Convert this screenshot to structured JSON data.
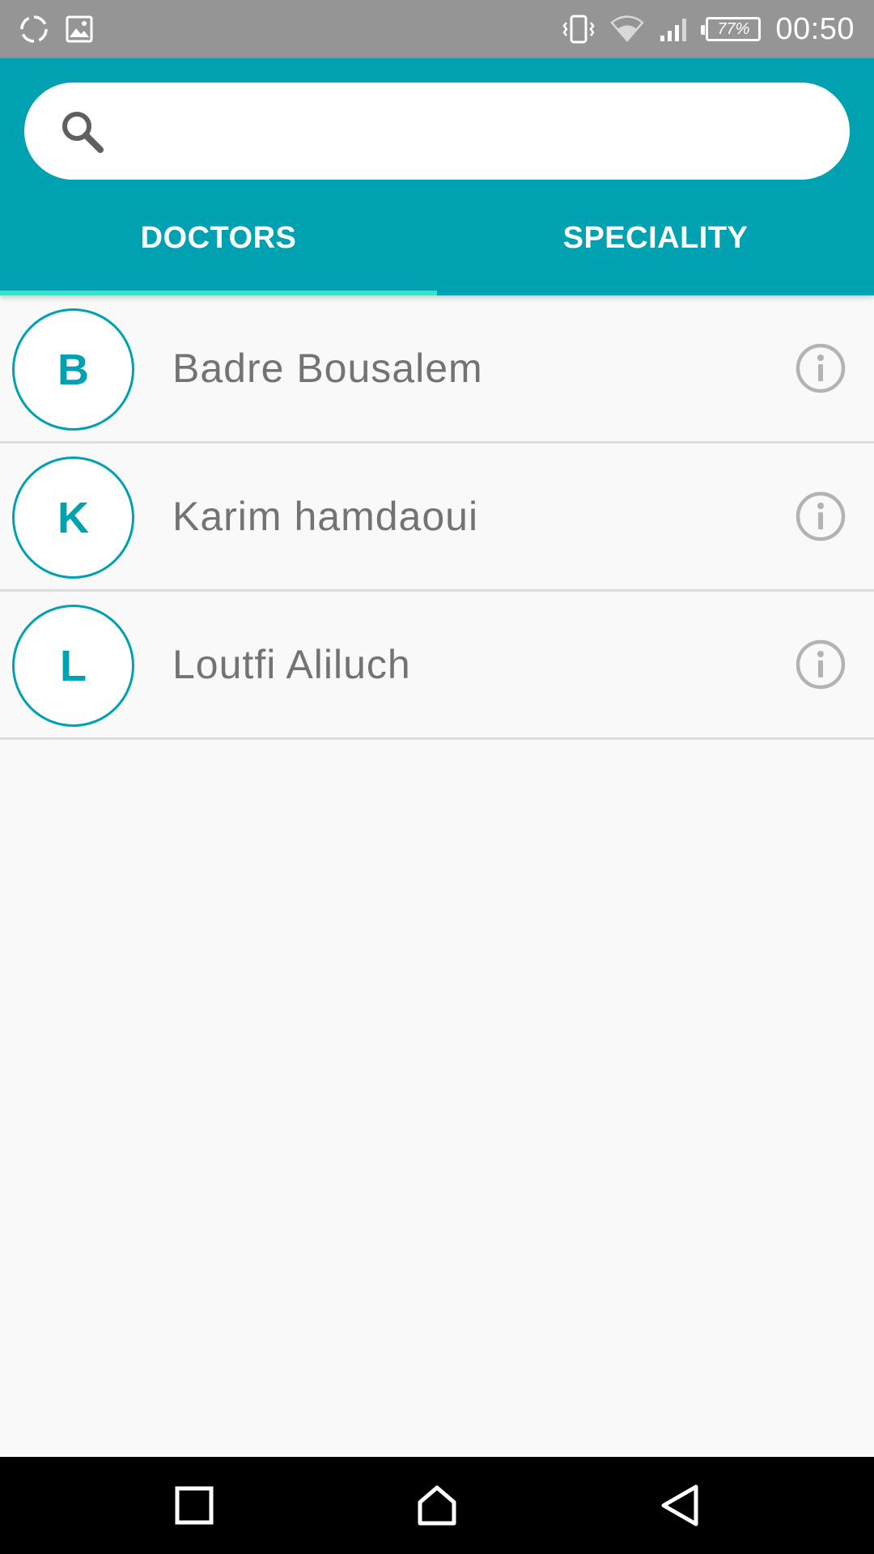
{
  "status_bar": {
    "time": "00:50",
    "battery": "77%",
    "icons": [
      "sync-icon",
      "image-icon",
      "vibrate-icon",
      "wifi-icon",
      "signal-icon",
      "battery-icon"
    ]
  },
  "search": {
    "value": "",
    "placeholder": "",
    "icon": "search-icon"
  },
  "tabs": [
    {
      "label": "DOCTORS",
      "selected": true
    },
    {
      "label": "SPECIALITY",
      "selected": false
    }
  ],
  "doctors": [
    {
      "initial": "B",
      "name": "Badre Bousalem"
    },
    {
      "initial": "K",
      "name": "Karim hamdaoui"
    },
    {
      "initial": "L",
      "name": "Loutfi Aliluch"
    }
  ],
  "nav_bar": {
    "icons": [
      "recent-apps-icon",
      "home-icon",
      "back-icon"
    ]
  },
  "colors": {
    "primary": "#00a1b1",
    "tab_indicator": "#3ee0c6",
    "status_bar": "#959595",
    "name_text": "#737373",
    "info_icon": "#b3b3b3"
  }
}
